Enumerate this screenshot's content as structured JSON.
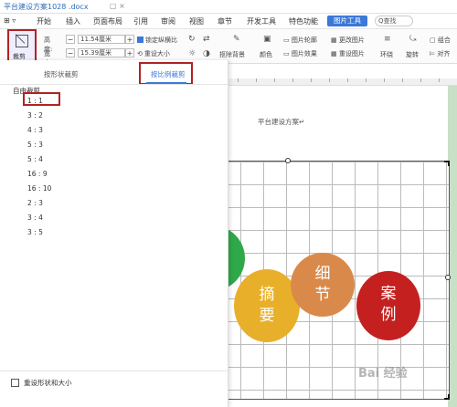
{
  "titlebar": {
    "doc_title": "平台建设方案1028 .docx"
  },
  "menubar": {
    "items": [
      "开始",
      "插入",
      "页面布局",
      "引用",
      "审阅",
      "视图",
      "章节",
      "开发工具",
      "特色功能"
    ],
    "picture_tools": "图片工具",
    "search": "Q查找"
  },
  "toolbar": {
    "crop_label": "裁剪",
    "height_label": "高度:",
    "height_value": "11.54厘米",
    "width_label": "宽度:",
    "width_value": "15.39厘米",
    "lock_ratio": "锁定纵横比",
    "reset_size": "重设大小",
    "remove_bg": "抠除背景",
    "color": "颜色",
    "pic_outline": "图片轮廓",
    "pic_effect": "图片效果",
    "change_pic": "更改图片",
    "reset_pic": "重设图片",
    "wrap": "环绕",
    "rotate": "旋转",
    "group": "组合",
    "align": "对齐"
  },
  "panel": {
    "tab_shape": "按形状裁剪",
    "tab_ratio": "按比例裁剪",
    "free_crop": "自由裁剪",
    "ratios": [
      "1 : 1",
      "3 : 2",
      "4 : 3",
      "5 : 3",
      "5 : 4",
      "16 : 9",
      "16 : 10",
      "2 : 3",
      "3 : 4",
      "3 : 5"
    ],
    "reset_label": "重设形状和大小"
  },
  "document": {
    "page_title": "平台建设方案↵"
  },
  "diagram": {
    "bubbles": [
      {
        "text": "摘\n要",
        "color": "#e8b02a"
      },
      {
        "text": "细\n节",
        "color": "#d98a4a"
      },
      {
        "text": "案\n例",
        "color": "#c42020"
      }
    ],
    "green_color": "#2fa84a"
  },
  "watermark": "Bai 经验"
}
